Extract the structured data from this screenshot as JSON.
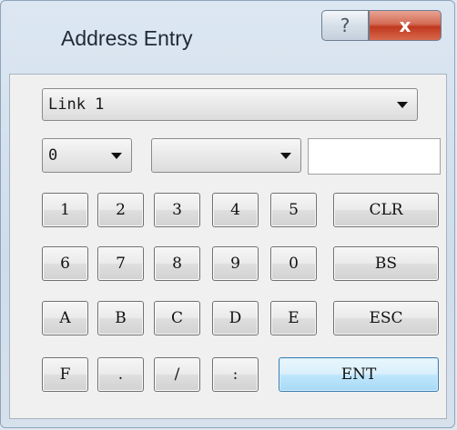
{
  "window": {
    "title": "Address Entry",
    "help_label": "?",
    "close_label": "x"
  },
  "link_combo": {
    "value": "Link 1"
  },
  "address_row": {
    "combo1_value": "0",
    "combo2_value": "",
    "input_value": "",
    "input_placeholder": ""
  },
  "keypad": {
    "rows": [
      [
        "1",
        "2",
        "3",
        "4",
        "5",
        "CLR"
      ],
      [
        "6",
        "7",
        "8",
        "9",
        "0",
        "BS"
      ],
      [
        "A",
        "B",
        "C",
        "D",
        "E",
        "ESC"
      ],
      [
        "F",
        ".",
        "/",
        ":",
        "ENT"
      ]
    ]
  }
}
